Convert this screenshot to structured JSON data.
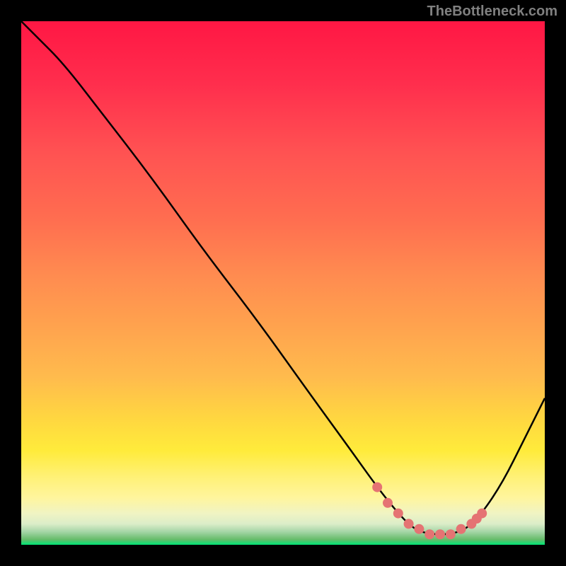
{
  "watermark": "TheBottleneck.com",
  "chart_data": {
    "type": "line",
    "title": "",
    "xlabel": "",
    "ylabel": "",
    "x_range": [
      0,
      100
    ],
    "y_range": [
      0,
      100
    ],
    "background_gradient": {
      "type": "vertical",
      "stops": [
        {
          "position": 0,
          "color": "#FF1744"
        },
        {
          "position": 25,
          "color": "#FF5252"
        },
        {
          "position": 45,
          "color": "#FF8A50"
        },
        {
          "position": 65,
          "color": "#FFB74D"
        },
        {
          "position": 78,
          "color": "#FFEB3B"
        },
        {
          "position": 88,
          "color": "#FFF59D"
        },
        {
          "position": 94,
          "color": "#F0F4C3"
        },
        {
          "position": 97,
          "color": "#C5E1A5"
        },
        {
          "position": 100,
          "color": "#00E676"
        }
      ]
    },
    "series": [
      {
        "name": "bottleneck-curve",
        "type": "line",
        "color": "#000000",
        "x": [
          0,
          3,
          8,
          15,
          25,
          35,
          45,
          55,
          63,
          68,
          72,
          75,
          78,
          82,
          85,
          88,
          92,
          96,
          100
        ],
        "y": [
          100,
          97,
          92,
          83,
          70,
          56,
          43,
          29,
          18,
          11,
          6,
          3,
          2,
          2,
          3,
          6,
          12,
          20,
          28
        ]
      },
      {
        "name": "optimal-points",
        "type": "scatter",
        "color": "#E57373",
        "marker_size": 7,
        "x": [
          68,
          70,
          72,
          74,
          76,
          78,
          80,
          82,
          84,
          86,
          87,
          88
        ],
        "y": [
          11,
          8,
          6,
          4,
          3,
          2,
          2,
          2,
          3,
          4,
          5,
          6
        ]
      }
    ]
  }
}
